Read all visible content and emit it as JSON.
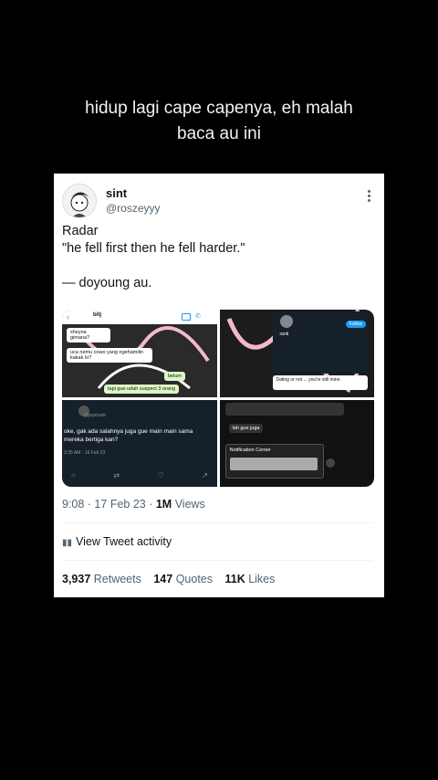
{
  "caption": {
    "line1": "hidup lagi cape capenya, eh malah",
    "line2": "baca au ini"
  },
  "tweet": {
    "name": "sint",
    "handle": "@roszeyyy",
    "text_line1": "Radar",
    "text_line2": "\"he fell first then he fell harder.\"",
    "text_line3": "— doyoung au.",
    "timestamp": "9:08 · 17 Feb 23 · ",
    "views_count": "1M",
    "views_label": " Views",
    "activity_label": "View Tweet activity",
    "retweets_count": "3,937",
    "retweets_label": " Retweets",
    "quotes_count": "147",
    "quotes_label": " Quotes",
    "likes_count": "11K",
    "likes_label": " Likes"
  },
  "media": {
    "tile1": {
      "contact": "bitj",
      "msg1": "sheyna gimana?",
      "msg2": "uca nemu cowo yang ngehamilin kakak lo?",
      "msg3": "belum",
      "msg4": "tapi gue udah suspect 3 orang"
    },
    "tile2": {
      "profile": "ranti",
      "btn": "Follow",
      "note": "Dating or not ... you're still mine."
    },
    "tile3": {
      "handle": "@jeprivate",
      "msg": "oke, gak ada salahnya juga gue main main sama mereka bertiga kan?",
      "time": "3:35 AM · 16 Feb 23"
    },
    "tile4": {
      "msg": "lah gue juga",
      "title": "Notification Center"
    }
  }
}
